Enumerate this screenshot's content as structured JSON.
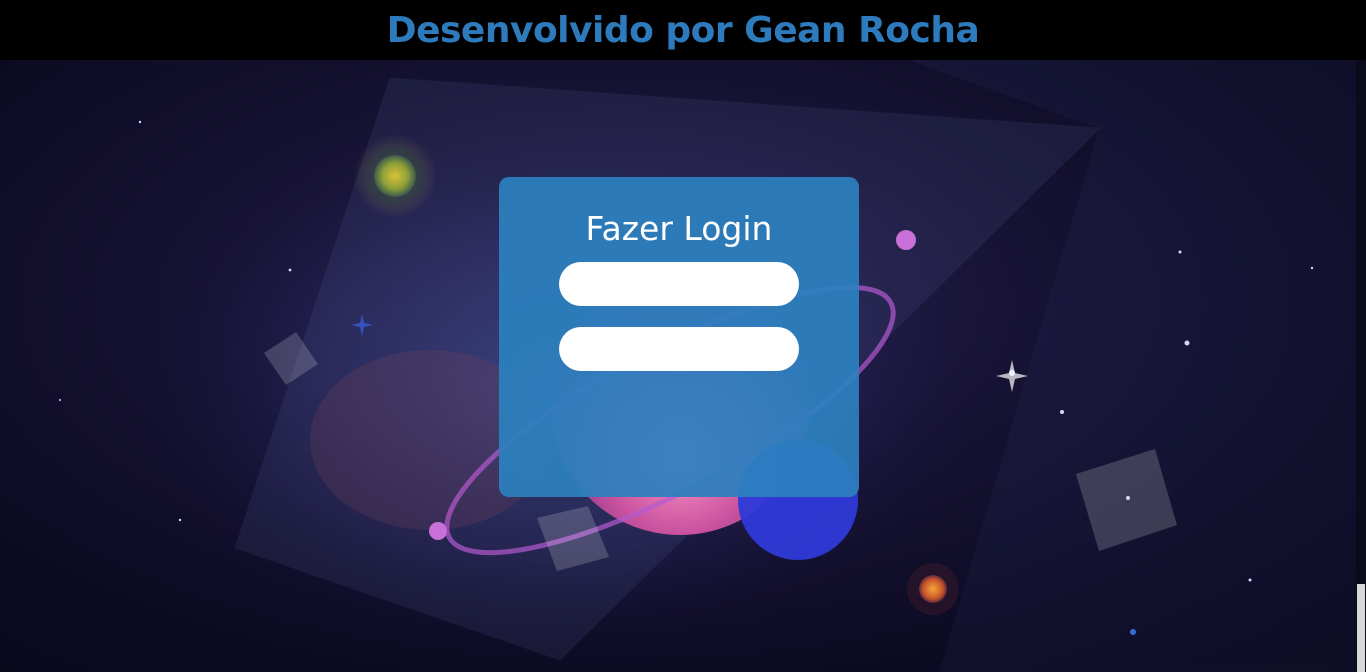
{
  "header": {
    "title": "Desenvolvido por Gean Rocha",
    "title_color": "#2d7bbd",
    "background": "#000000"
  },
  "login": {
    "title": "Fazer Login",
    "card_color": "#2c80be",
    "username": {
      "value": "",
      "placeholder": ""
    },
    "password": {
      "value": "",
      "placeholder": ""
    },
    "submit_label": ""
  },
  "background": {
    "theme": "space-illustration",
    "icons": [
      "planet-icon",
      "star-icon",
      "diamond-shape-icon"
    ]
  }
}
